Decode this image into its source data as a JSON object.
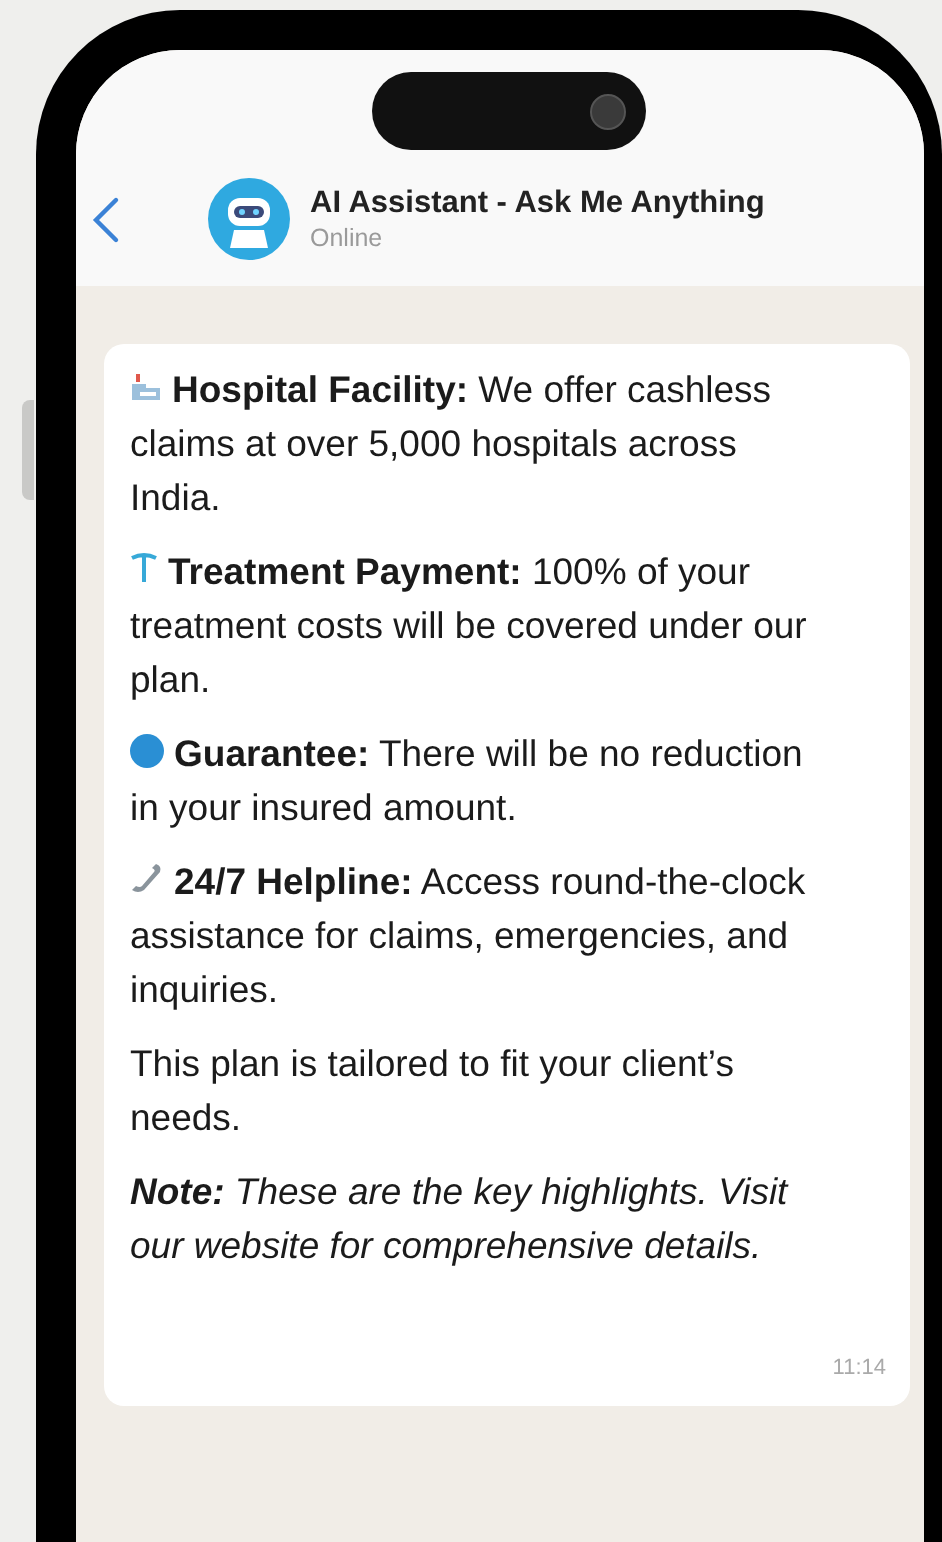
{
  "header": {
    "title": "AI Assistant - Ask Me Anything",
    "status": "Online"
  },
  "message": {
    "paragraphs": [
      {
        "kind": "hospital",
        "text": "**Hospital Facility:** We offer cashless claims at over 5,000 hospitals across India.",
        "italic": false
      },
      {
        "kind": "medical",
        "text": "**Treatment Payment:** 100% of your treatment costs will be covered under our plan.",
        "italic": false
      },
      {
        "kind": "dot",
        "text": "**Guarantee:** There will be no reduction in your insured amount.",
        "italic": false
      },
      {
        "kind": "phone",
        "text": "**24/7 Helpline:** Access round-the-clock assistance for claims, emergencies, and inquiries.",
        "italic": false
      },
      {
        "kind": "plain",
        "text": "This plan is tailored to fit your client’s needs.",
        "italic": false
      },
      {
        "kind": "plain",
        "text": "**Note:** These are the key highlights. Visit our website for comprehensive details.",
        "italic": true
      }
    ],
    "time": "11:14"
  }
}
